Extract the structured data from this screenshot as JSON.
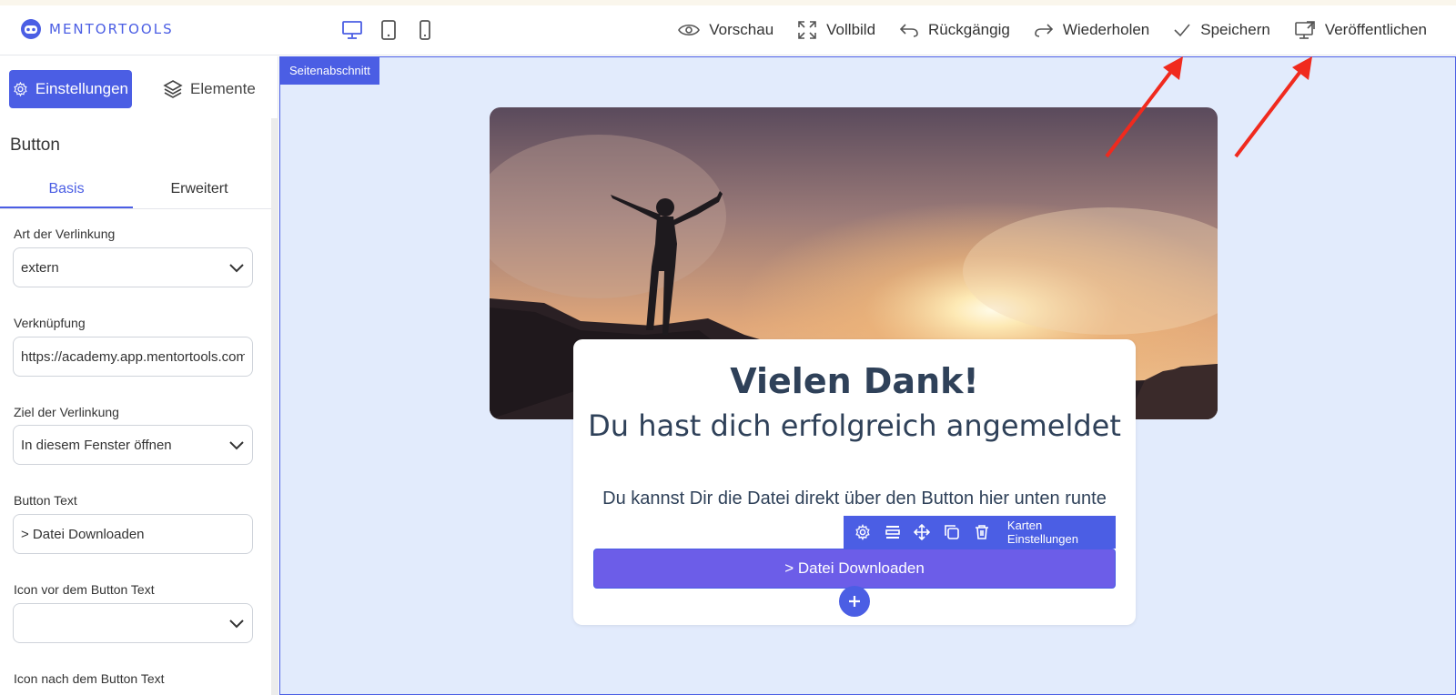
{
  "brand": {
    "name": "MENTORTOOLS",
    "accent": "#4b5ee4"
  },
  "toolbar": {
    "devices": [
      "desktop-icon",
      "tablet-icon",
      "mobile-icon"
    ],
    "actions": [
      {
        "label": "Vorschau",
        "icon": "eye-icon"
      },
      {
        "label": "Vollbild",
        "icon": "expand-icon"
      },
      {
        "label": "Rückgängig",
        "icon": "undo-icon"
      },
      {
        "label": "Wiederholen",
        "icon": "redo-icon"
      },
      {
        "label": "Speichern",
        "icon": "check-icon"
      },
      {
        "label": "Veröffentlichen",
        "icon": "publish-icon"
      }
    ]
  },
  "sidebar": {
    "tabs": [
      {
        "label": "Einstellungen",
        "icon": "gear-icon"
      },
      {
        "label": "Elemente",
        "icon": "layers-icon"
      }
    ],
    "title": "Button",
    "subtabs": [
      "Basis",
      "Erweitert"
    ],
    "fields": [
      {
        "label": "Art der Verlinkung",
        "value": "extern",
        "type": "select"
      },
      {
        "label": "Verknüpfung",
        "value": "https://academy.app.mentortools.com",
        "type": "text"
      },
      {
        "label": "Ziel der Verlinkung",
        "value": "In diesem Fenster öffnen",
        "type": "select"
      },
      {
        "label": "Button Text",
        "value": "> Datei Downloaden",
        "type": "text"
      },
      {
        "label": "Icon vor dem Button Text",
        "value": "",
        "type": "select"
      },
      {
        "label": "Icon nach dem Button Text",
        "value": "",
        "type": "select"
      }
    ]
  },
  "canvas": {
    "section_label": "Seitenabschnitt",
    "card": {
      "title": "Vielen Dank!",
      "subtitle": "Du hast dich erfolgreich angemeldet",
      "body": "Du kannst Dir die Datei direkt über den Button hier unten runte",
      "card_toolbar_label": "Karten Einstellungen",
      "button_label": "> Datei Downloaden"
    }
  }
}
